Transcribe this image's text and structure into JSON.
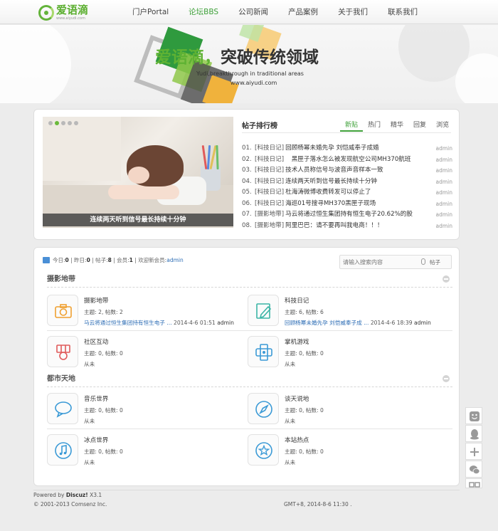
{
  "logo": {
    "text": "爱语滴",
    "url": "www.aiyudi.com"
  },
  "nav": {
    "items": [
      {
        "label": "门户Portal"
      },
      {
        "label": "论坛BBS",
        "active": true
      },
      {
        "label": "公司新闻"
      },
      {
        "label": "产品案例"
      },
      {
        "label": "关于我们"
      },
      {
        "label": "联系我们"
      }
    ]
  },
  "banner": {
    "title_green": "爱语滴，",
    "title_dark": "突破",
    "title_green2": "传统领域",
    "subtitle": "Yudi,breakthrough in traditional areas",
    "url": "www.aiyudi.com"
  },
  "slide": {
    "caption": "连续两天听到信号最长持续十分钟"
  },
  "ranking": {
    "title": "帖子排行榜",
    "tabs": [
      "新贴",
      "热门",
      "精华",
      "回复",
      "浏览"
    ],
    "rows": [
      {
        "num": "01.",
        "cat": "[科技日记]",
        "text": "回顾杨幂未婚先孕 刘恺威奉子成婚",
        "author": "admin"
      },
      {
        "num": "02.",
        "cat": "[科技日记]",
        "text": "　黑匣子落水怎么被发现航空公司MH370航班",
        "author": "admin"
      },
      {
        "num": "03.",
        "cat": "[科技日记]",
        "text": "技术人员称信号与波音声音样本一致",
        "author": "admin"
      },
      {
        "num": "04.",
        "cat": "[科技日记]",
        "text": "连续两天听到信号最长持续十分钟",
        "author": "admin"
      },
      {
        "num": "05.",
        "cat": "[科技日记]",
        "text": "杜海涛微博收费转发可以停止了",
        "author": "admin"
      },
      {
        "num": "06.",
        "cat": "[科技日记]",
        "text": "海巡01号搜寻MH370黑匣子现场",
        "author": "admin"
      },
      {
        "num": "07.",
        "cat": "[摄影地带]",
        "text": "马云将通过恒生集团持有恒生电子20.62%的股",
        "author": "admin"
      },
      {
        "num": "08.",
        "cat": "[摄影地带]",
        "text": "阿里巴巴：请不要再叫我电商！！！",
        "author": "admin"
      }
    ]
  },
  "stats": {
    "today_label": "今日:",
    "today": "0",
    "yesterday_label": "昨日:",
    "yesterday": "0",
    "posts_label": "帖子:",
    "posts": "8",
    "members_label": "会员:",
    "members": "1",
    "newest_label": "欢迎新会员:",
    "newest": "admin"
  },
  "search": {
    "placeholder": "请输入搜索内容",
    "scope": "帖子"
  },
  "sections": [
    {
      "title": "摄影地带",
      "forums": [
        {
          "name": "摄影地带",
          "count": "主题: 2, 帖数: 2",
          "last_title": "马云将通过恒生集团持有恒生电子 ...",
          "last_time": "2014-4-6 01:51",
          "last_author": "admin",
          "icon": "camera-icon"
        },
        {
          "name": "科技日记",
          "count": "主题: 6, 帖数: 6",
          "last_title": "回顾杨幂未婚先孕 刘恺威奉子成 ...",
          "last_time": "2014-4-6 18:39",
          "last_author": "admin",
          "icon": "note-icon"
        },
        {
          "name": "社区互动",
          "count": "主题: 0, 帖数: 0",
          "last_never": "从未",
          "icon": "medal-icon"
        },
        {
          "name": "掌机游戏",
          "count": "主题: 0, 帖数: 0",
          "last_never": "从未",
          "icon": "gamepad-icon"
        }
      ]
    },
    {
      "title": "都市天地",
      "forums": [
        {
          "name": "音乐世界",
          "count": "主题: 0, 帖数: 0",
          "last_never": "从未",
          "icon": "speech-bubble-icon"
        },
        {
          "name": "谈天说地",
          "count": "主题: 0, 帖数: 0",
          "last_never": "从未",
          "icon": "compass-icon"
        },
        {
          "name": "冰点世界",
          "count": "主题: 0, 帖数: 0",
          "last_never": "从未",
          "icon": "music-note-icon"
        },
        {
          "name": "本站热点",
          "count": "主题: 0, 帖数: 0",
          "last_never": "从未",
          "icon": "star-icon"
        }
      ]
    }
  ],
  "footer": {
    "powered": "Powered by",
    "brand": "Discuz!",
    "version": "X3.1",
    "copyright": "© 2001-2013 Comsenz Inc.",
    "time": "GMT+8, 2014-8-6 11:30 ."
  },
  "colors": {
    "accent": "#3fa13a",
    "link": "#2d6db5",
    "brand_green": "#5fb233"
  }
}
